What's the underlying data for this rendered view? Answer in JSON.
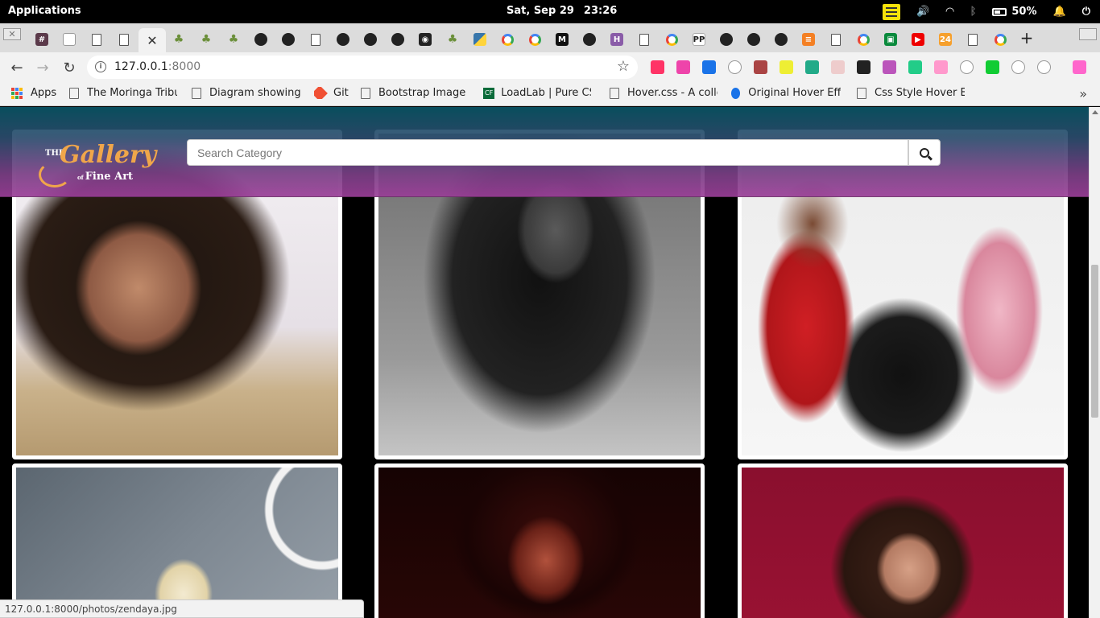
{
  "os": {
    "apps_label": "Applications",
    "date": "Sat, Sep 29",
    "time": "23:26",
    "battery": "50%"
  },
  "browser": {
    "url_host": "127.0.0.1",
    "url_port": ":8000",
    "status_url": "127.0.0.1:8000/photos/zendaya.jpg"
  },
  "bookmarks": [
    {
      "label": "Apps"
    },
    {
      "label": "The Moringa Tribune"
    },
    {
      "label": "Diagram showing how"
    },
    {
      "label": "Git"
    },
    {
      "label": "Bootstrap Image Hover"
    },
    {
      "label": "LoadLab | Pure CSS"
    },
    {
      "label": "Hover.css - A collection"
    },
    {
      "label": "Original Hover Effects"
    },
    {
      "label": "Css Style Hover Effects"
    }
  ],
  "site": {
    "logo_the": "THE",
    "logo_gallery": "Gallery",
    "logo_fine": "Fine Art",
    "logo_of": "of",
    "search_placeholder": "Search Category"
  },
  "colors": {
    "header_top": "#0a5566",
    "header_bottom": "#9a3e97",
    "logo_accent": "#f0a64a"
  }
}
